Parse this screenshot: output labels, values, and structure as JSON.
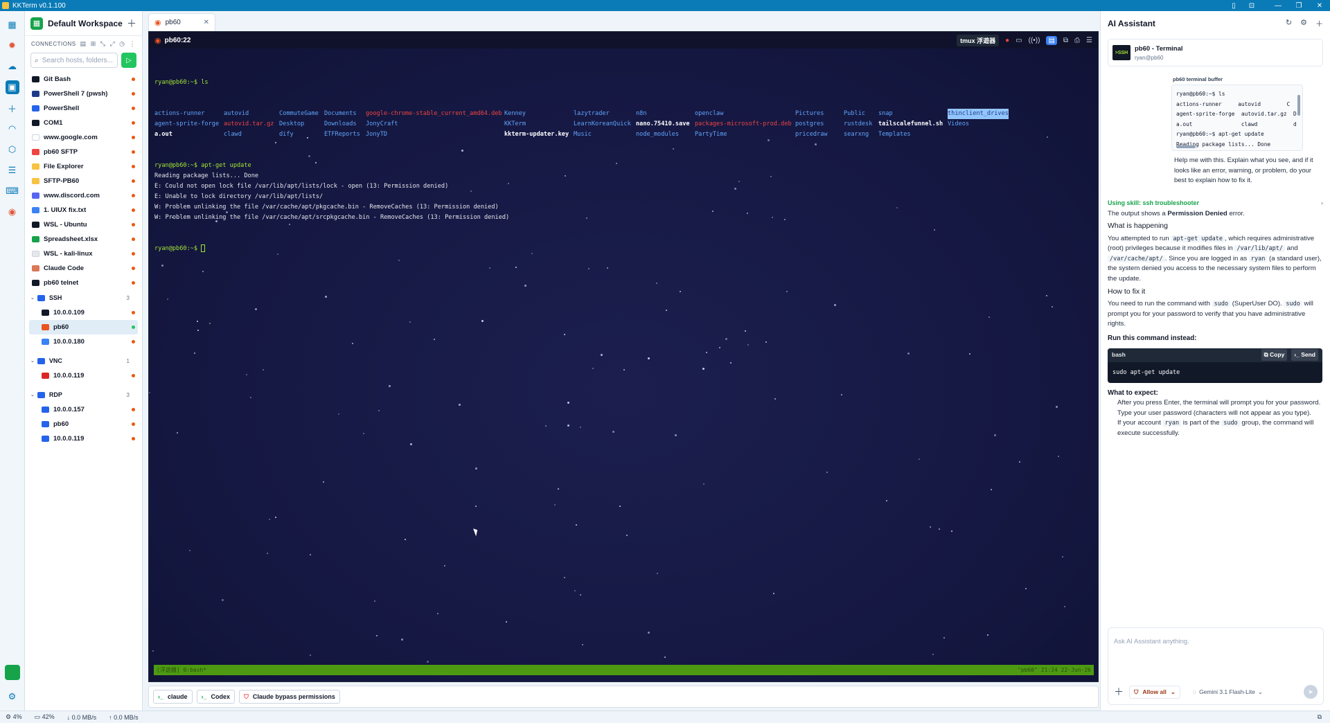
{
  "app": {
    "title": "KKTerm v0.1.100"
  },
  "workspace": {
    "title": "Default Workspace"
  },
  "connections": {
    "header": "CONNECTIONS",
    "search_placeholder": "Search hosts, folders...",
    "items": [
      {
        "label": "Git Bash",
        "icon": "terminal-icon",
        "color": "#111827"
      },
      {
        "label": "PowerShell 7 (pwsh)",
        "icon": "powershell-icon",
        "color": "#1e3a8a"
      },
      {
        "label": "PowerShell",
        "icon": "powershell-icon",
        "color": "#2563eb"
      },
      {
        "label": "COM1",
        "icon": "serial-icon",
        "color": "#111827"
      },
      {
        "label": "www.google.com",
        "icon": "google-icon",
        "color": "#ffffff"
      },
      {
        "label": "pb60 SFTP",
        "icon": "sftp-icon",
        "color": "#ef4444"
      },
      {
        "label": "File Explorer",
        "icon": "folder-icon",
        "color": "#f6c343"
      },
      {
        "label": "SFTP-PB60",
        "icon": "folder-icon",
        "color": "#f6c343"
      },
      {
        "label": "www.discord.com",
        "icon": "discord-icon",
        "color": "#5865f2"
      },
      {
        "label": "1. UIUX fix.txt",
        "icon": "file-icon",
        "color": "#3b82f6"
      },
      {
        "label": "WSL - Ubuntu",
        "icon": "wsl-icon",
        "color": "#111827"
      },
      {
        "label": "Spreadsheet.xlsx",
        "icon": "spreadsheet-icon",
        "color": "#16a34a"
      },
      {
        "label": "WSL - kali-linux",
        "icon": "kali-icon",
        "color": "#e5e7eb"
      },
      {
        "label": "Claude Code",
        "icon": "claude-icon",
        "color": "#d97757"
      },
      {
        "label": "pb60 telnet",
        "icon": "telnet-icon",
        "color": "#111827"
      }
    ],
    "groups": [
      {
        "label": "SSH",
        "count": "3",
        "children": [
          {
            "label": "10.0.0.109",
            "color": "#111827",
            "status": "orange"
          },
          {
            "label": "pb60",
            "color": "#e95420",
            "status": "green",
            "selected": true
          },
          {
            "label": "10.0.0.180",
            "color": "#3b82f6",
            "status": "orange"
          }
        ]
      },
      {
        "label": "VNC",
        "count": "1",
        "children": [
          {
            "label": "10.0.0.119",
            "color": "#dc2626",
            "status": "orange"
          }
        ]
      },
      {
        "label": "RDP",
        "count": "3",
        "children": [
          {
            "label": "10.0.0.157",
            "color": "#2563eb",
            "status": "orange"
          },
          {
            "label": "pb60",
            "color": "#2563eb",
            "status": "orange"
          },
          {
            "label": "10.0.0.119",
            "color": "#2563eb",
            "status": "orange"
          }
        ]
      }
    ]
  },
  "tab": {
    "label": "pb60"
  },
  "terminal": {
    "host": "pb60:22",
    "tmux_label": "tmux 浮遊器",
    "cmd_ls": "ryan@pb60:~$ ls",
    "ls_rows": [
      [
        {
          "t": "actions-runner",
          "c": "c-cyan"
        },
        {
          "t": "autovid",
          "c": "c-cyan"
        },
        {
          "t": "CommuteGame",
          "c": "c-cyan"
        },
        {
          "t": "Documents",
          "c": "c-cyan"
        },
        {
          "t": "google-chrome-stable_current_amd64.deb",
          "c": "c-red"
        },
        {
          "t": "Kenney",
          "c": "c-cyan"
        },
        {
          "t": "lazytrader",
          "c": "c-cyan"
        },
        {
          "t": "n8n",
          "c": "c-cyan"
        },
        {
          "t": "openclaw",
          "c": "c-cyan"
        },
        {
          "t": "Pictures",
          "c": "c-cyan"
        },
        {
          "t": "Public",
          "c": "c-cyan"
        },
        {
          "t": "snap",
          "c": "c-cyan"
        },
        {
          "t": "thinclient_drives",
          "c": "c-hl"
        }
      ],
      [
        {
          "t": "agent-sprite-forge",
          "c": "c-cyan"
        },
        {
          "t": "autovid.tar.gz",
          "c": "c-red"
        },
        {
          "t": "Desktop",
          "c": "c-cyan"
        },
        {
          "t": "Downloads",
          "c": "c-cyan"
        },
        {
          "t": "JonyCraft",
          "c": "c-cyan"
        },
        {
          "t": "KKTerm",
          "c": "c-cyan"
        },
        {
          "t": "LearnKoreanQuick",
          "c": "c-cyan"
        },
        {
          "t": "nano.75410.save",
          "c": "c-white"
        },
        {
          "t": "packages-microsoft-prod.deb",
          "c": "c-red"
        },
        {
          "t": "postgres",
          "c": "c-cyan"
        },
        {
          "t": "rustdesk",
          "c": "c-cyan"
        },
        {
          "t": "tailscalefunnel.sh",
          "c": "c-white"
        },
        {
          "t": "Videos",
          "c": "c-cyan"
        }
      ],
      [
        {
          "t": "a.out",
          "c": "c-white"
        },
        {
          "t": "clawd",
          "c": "c-cyan"
        },
        {
          "t": "dify",
          "c": "c-cyan"
        },
        {
          "t": "ETFReports",
          "c": "c-cyan"
        },
        {
          "t": "JonyTD",
          "c": "c-cyan"
        },
        {
          "t": "kkterm-updater.key",
          "c": "c-white"
        },
        {
          "t": "Music",
          "c": "c-cyan"
        },
        {
          "t": "node_modules",
          "c": "c-cyan"
        },
        {
          "t": "PartyTime",
          "c": "c-cyan"
        },
        {
          "t": "pricedraw",
          "c": "c-cyan"
        },
        {
          "t": "searxng",
          "c": "c-cyan"
        },
        {
          "t": "Templates",
          "c": "c-cyan"
        },
        {
          "t": "",
          "c": ""
        }
      ]
    ],
    "output_lines": [
      "ryan@pb60:~$ apt-get update",
      "Reading package lists... Done",
      "E: Could not open lock file /var/lib/apt/lists/lock - open (13: Permission denied)",
      "E: Unable to lock directory /var/lib/apt/lists/",
      "W: Problem unlinking the file /var/cache/apt/pkgcache.bin - RemoveCaches (13: Permission denied)",
      "W: Problem unlinking the file /var/cache/apt/srcpkgcache.bin - RemoveCaches (13: Permission denied)"
    ],
    "final_prompt": "ryan@pb60:~$ ",
    "status_left": "[浮遊器] 0:bash*",
    "status_right": "\"pb60\" 21:24 22-Jun-26"
  },
  "quick_actions": [
    {
      "label": "claude",
      "icon": "terminal-icon"
    },
    {
      "label": "Codex",
      "icon": "terminal-icon"
    },
    {
      "label": "Claude bypass permissions",
      "icon": "shield-icon"
    }
  ],
  "status_bar": {
    "cpu": "4%",
    "mem": "42%",
    "down": "0.0 MB/s",
    "up": "0.0 MB/s"
  },
  "ai": {
    "title": "AI Assistant",
    "context_name": "pb60 - Terminal",
    "context_sub": "ryan@pb60",
    "ssh_badge": ">SSH",
    "buffer_label": "pb60 terminal buffer",
    "buffer_lines": [
      "ryan@pb60:~$ ls",
      "actions-runner     autovid        C",
      "agent-sprite-forge  autovid.tar.gz  D",
      "a.out               clawd           d",
      "ryan@pb60:~$ apt-get update",
      "Reading package lists... Done"
    ],
    "user_prompt": "Help me with this. Explain what you see, and if it looks like an error, warning, or problem, do your best to explain how to fix it.",
    "skill": "Using skill: ssh troubleshooter",
    "intro_pre": "The output shows a ",
    "intro_bold": "Permission Denied",
    "intro_post": " error.",
    "h_happening": "What is happening",
    "p1_a": "You attempted to run ",
    "p1_code1": "apt-get update",
    "p1_b": ", which requires administrative (root) privileges because it modifies files in ",
    "p1_code2": "/var/lib/apt/",
    "p1_c": " and ",
    "p1_code3": "/var/cache/apt/",
    "p1_d": ". Since you are logged in as ",
    "p1_code4": "ryan",
    "p1_e": " (a standard user), the system denied you access to the necessary system files to perform the update.",
    "h_fix": "How to fix it",
    "p2_a": "You need to run the command with ",
    "p2_code1": "sudo",
    "p2_b": " (SuperUser DO). ",
    "p2_code2": "sudo",
    "p2_c": " will prompt you for your password to verify that you have administrative rights.",
    "h_run": "Run this command instead:",
    "code_lang": "bash",
    "copy_label": "Copy",
    "send_label": "Send",
    "code": "sudo apt-get update",
    "h_expect": "What to expect:",
    "e1": "After you press Enter, the terminal will prompt you for your password.",
    "e2": "Type your user password (characters will not appear as you type).",
    "e3_a": "If your account ",
    "e3_code1": "ryan",
    "e3_b": " is part of the ",
    "e3_code2": "sudo",
    "e3_c": " group, the command will execute successfully.",
    "composer_placeholder": "Ask AI Assistant anything.",
    "allow_label": "Allow all",
    "model_label": "Gemini 3.1 Flash-Lite"
  },
  "colors": {
    "accent": "#0a7bb7",
    "terminal_bg": "#151842",
    "tmux_status": "#4d9a12"
  }
}
